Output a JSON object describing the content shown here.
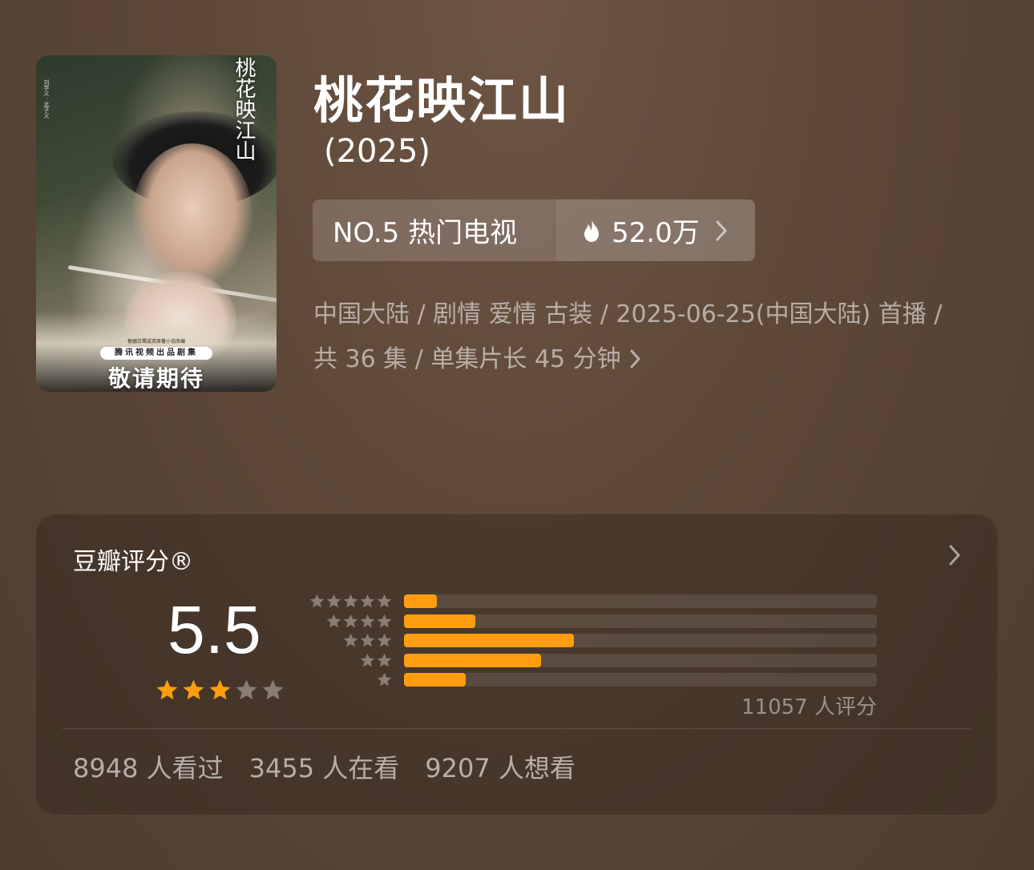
{
  "poster": {
    "title": "桃花映江山",
    "cast": "刘学义 · 孟子义",
    "small_text": "根据白鹭成双原著小说改编",
    "badge": "腾讯视频出品剧集",
    "tagline": "敬请期待"
  },
  "header": {
    "title": "桃花映江山",
    "year": "(2025)"
  },
  "rank": {
    "label": "NO.5 热门电视",
    "heat": "52.0万"
  },
  "meta": {
    "line1": "中国大陆 / 剧情 爱情 古装 / 2025-06-25(中国大陆) 首播 /",
    "line2": "共 36 集 / 单集片长 45 分钟"
  },
  "rating": {
    "title": "豆瓣评分®",
    "score": "5.5",
    "stars_filled": 3,
    "stars_total": 5,
    "distribution": [
      {
        "stars": 5,
        "percent": 7
      },
      {
        "stars": 4,
        "percent": 15
      },
      {
        "stars": 3,
        "percent": 36
      },
      {
        "stars": 2,
        "percent": 29
      },
      {
        "stars": 1,
        "percent": 13
      }
    ],
    "raters": "11057 人评分",
    "star_color": "#ff9d0e",
    "star_empty_color": "#8a7d74"
  },
  "stats": {
    "watched": "8948 人看过",
    "watching": "3455 人在看",
    "wish": "9207 人想看"
  }
}
